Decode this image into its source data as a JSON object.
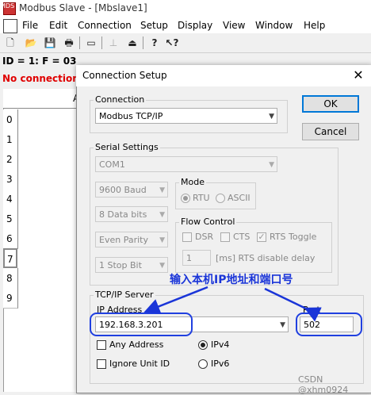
{
  "app": {
    "title": "Modbus Slave - [Mbslave1]",
    "icon_label": "MDS"
  },
  "menu": [
    "File",
    "Edit",
    "Connection",
    "Setup",
    "Display",
    "View",
    "Window",
    "Help"
  ],
  "toolbar": {
    "icons": [
      "new-document-icon",
      "open-folder-icon",
      "save-icon",
      "print-icon",
      "window-icon",
      "connect-icon",
      "disconnect-icon",
      "help-icon",
      "context-help-icon"
    ]
  },
  "status": {
    "id_line": "ID = 1: F = 03",
    "connection": "No connection"
  },
  "grid": {
    "column_header": "A",
    "rows": [
      "0",
      "1",
      "2",
      "3",
      "4",
      "5",
      "6",
      "7",
      "8",
      "9"
    ]
  },
  "dialog": {
    "title": "Connection Setup",
    "close": "✕",
    "ok_label": "OK",
    "cancel_label": "Cancel",
    "connection": {
      "group_label": "Connection",
      "value": "Modbus TCP/IP"
    },
    "serial": {
      "group_label": "Serial Settings",
      "port": "COM1",
      "baud": "9600 Baud",
      "data_bits": "8 Data bits",
      "parity": "Even Parity",
      "stop_bits": "1 Stop Bit",
      "mode": {
        "group_label": "Mode",
        "rtu": "RTU",
        "ascii": "ASCII"
      },
      "flow": {
        "group_label": "Flow Control",
        "dsr": "DSR",
        "cts": "CTS",
        "rts_toggle": "RTS Toggle",
        "delay_value": "1",
        "delay_label": "[ms] RTS disable delay"
      }
    },
    "tcp": {
      "group_label": "TCP/IP Server",
      "ip_label": "IP Address",
      "ip_value": "192.168.3.201",
      "port_label": "Port",
      "port_value": "502",
      "any_address": "Any Address",
      "ignore_unit_id": "Ignore Unit ID",
      "ipv4": "IPv4",
      "ipv6": "IPv6"
    }
  },
  "annotation": {
    "text": "输入本机IP地址和端口号",
    "color": "#1a35d8"
  },
  "watermark": "CSDN @xhm0924"
}
